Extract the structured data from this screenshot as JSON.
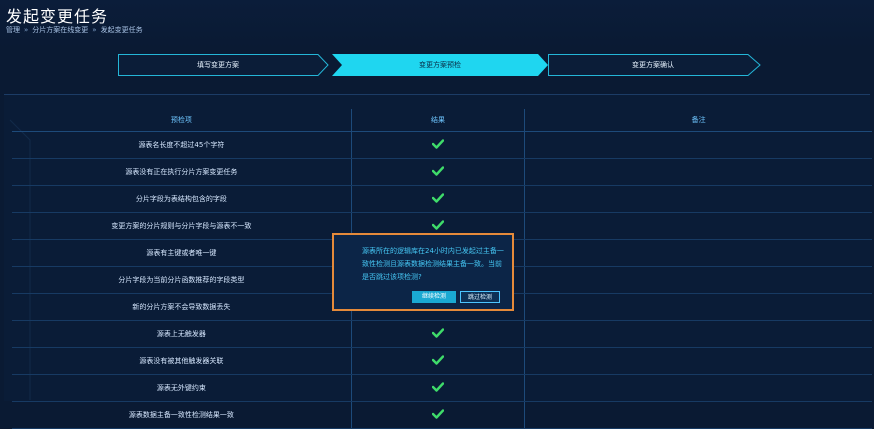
{
  "page": {
    "title": "发起变更任务"
  },
  "breadcrumb": {
    "items": [
      "管理",
      "分片方案在线变更",
      "发起变更任务"
    ],
    "separator": "»"
  },
  "steps": [
    {
      "label": "填写变更方案",
      "state": "done"
    },
    {
      "label": "变更方案预检",
      "state": "active"
    },
    {
      "label": "变更方案确认",
      "state": "pending"
    }
  ],
  "table": {
    "headers": [
      "预检项",
      "结果",
      "备注"
    ],
    "rows": [
      {
        "item": "源表名长度不超过45个字符",
        "result": "pass",
        "note": ""
      },
      {
        "item": "源表没有正在执行分片方案变更任务",
        "result": "pass",
        "note": ""
      },
      {
        "item": "分片字段为表结构包含的字段",
        "result": "pass",
        "note": ""
      },
      {
        "item": "变更方案的分片规则与分片字段与源表不一致",
        "result": "pass",
        "note": ""
      },
      {
        "item": "源表有主键或者唯一键",
        "result": "pass",
        "note": ""
      },
      {
        "item": "分片字段为当前分片函数推荐的字段类型",
        "result": "pass",
        "note": ""
      },
      {
        "item": "新的分片方案不会导致数据丢失",
        "result": "pass",
        "note": ""
      },
      {
        "item": "源表上无触发器",
        "result": "pass",
        "note": ""
      },
      {
        "item": "源表没有被其他触发器关联",
        "result": "pass",
        "note": ""
      },
      {
        "item": "源表无外键约束",
        "result": "pass",
        "note": ""
      },
      {
        "item": "源表数据主备一致性检测结果一致",
        "result": "pass",
        "note": ""
      }
    ]
  },
  "modal": {
    "message": "源表所在的逻辑库在24小时内已发起过主备一致性检测且源表数据检测结果主备一致。当前是否跳过该项检测?",
    "continue_label": "继续检测",
    "skip_label": "跳过检测"
  },
  "colors": {
    "accent": "#1fd6f0",
    "check": "#3fdc6a",
    "modal_border": "#e58a3a"
  }
}
